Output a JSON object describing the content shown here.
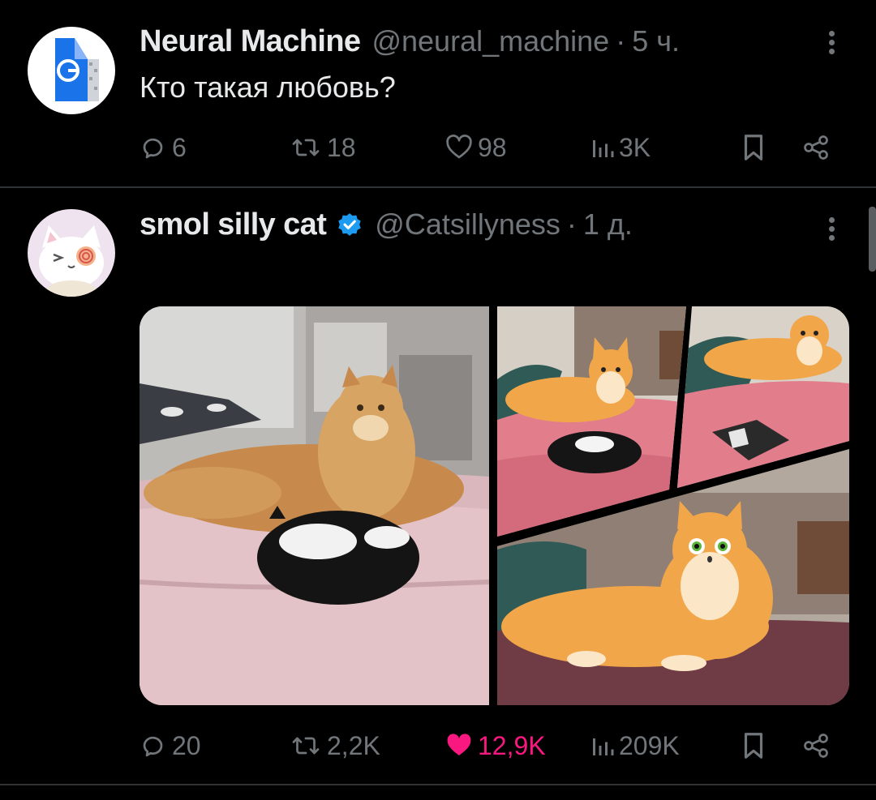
{
  "tweets": [
    {
      "author": "Neural Machine",
      "handle": "@neural_machine",
      "separator": "·",
      "time": "5 ч.",
      "text": "Кто такая любовь?",
      "actions": {
        "replies": "6",
        "reposts": "18",
        "likes": "98",
        "views": "3K"
      },
      "liked": false
    },
    {
      "author": "smol silly cat",
      "handle": "@Catsillyness",
      "separator": "·",
      "time": "1 д.",
      "verified": true,
      "media": [
        "cat-video-photo",
        "cat-comic-panels"
      ],
      "actions": {
        "replies": "20",
        "reposts": "2,2K",
        "likes": "12,9K",
        "views": "209K"
      },
      "liked": true
    }
  ],
  "colors": {
    "background": "#000000",
    "text": "#e7e9ea",
    "muted": "#71767b",
    "like_active": "#f91880",
    "verified": "#1d9bf0",
    "divider": "#2f3336"
  },
  "icons": [
    "more-icon",
    "reply-icon",
    "repost-icon",
    "like-icon",
    "views-icon",
    "bookmark-icon",
    "share-icon",
    "verified-icon"
  ]
}
